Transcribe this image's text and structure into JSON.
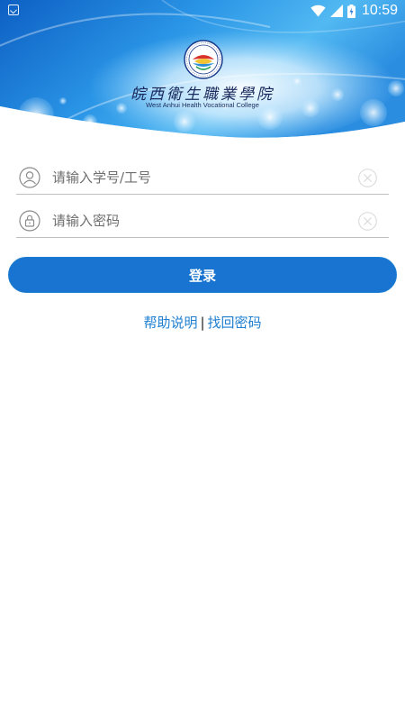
{
  "status_bar": {
    "time": "10:59",
    "icons": [
      "notification-app-icon",
      "wifi-icon",
      "cell-signal-icon",
      "battery-icon"
    ]
  },
  "header": {
    "school_name_cn": "皖西衛生職業學院",
    "school_name_en": "West Anhui Health Vocational College"
  },
  "login_form": {
    "username": {
      "placeholder": "请输入学号/工号",
      "value": "",
      "icon": "user-icon"
    },
    "password": {
      "placeholder": "请输入密码",
      "value": "",
      "icon": "lock-icon"
    },
    "clear_icon": "clear-circle-icon",
    "submit_label": "登录"
  },
  "links": {
    "help": "帮助说明",
    "separator": "|",
    "recover_password": "找回密码"
  },
  "colors": {
    "primary": "#1874d0",
    "link": "#1e7fd0",
    "banner_dark": "#0f63c6",
    "banner_light": "#64c3f5"
  }
}
